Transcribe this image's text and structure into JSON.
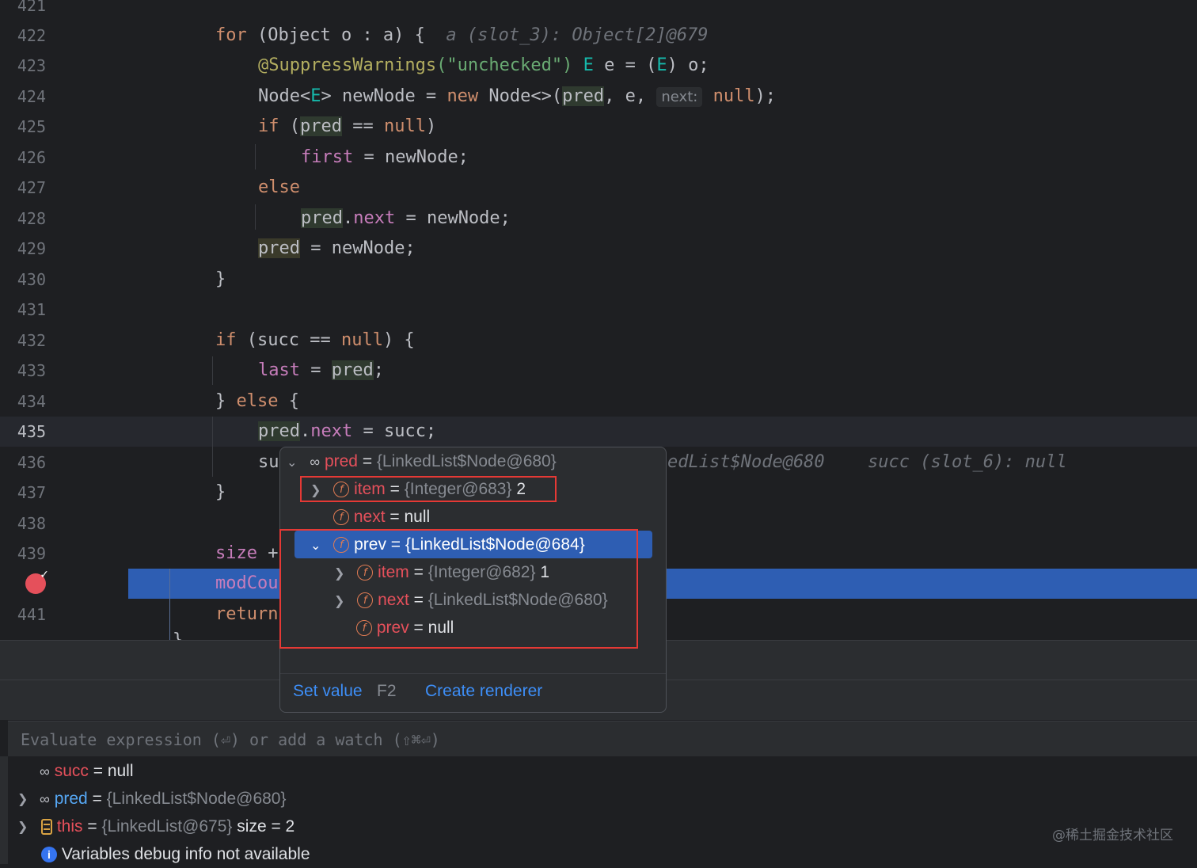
{
  "editor": {
    "lines": [
      {
        "n": "421"
      },
      {
        "n": "422"
      },
      {
        "n": "423"
      },
      {
        "n": "424"
      },
      {
        "n": "425"
      },
      {
        "n": "426"
      },
      {
        "n": "427"
      },
      {
        "n": "428"
      },
      {
        "n": "429"
      },
      {
        "n": "430"
      },
      {
        "n": "431"
      },
      {
        "n": "432"
      },
      {
        "n": "433"
      },
      {
        "n": "434"
      },
      {
        "n": "435"
      },
      {
        "n": "436"
      },
      {
        "n": "437"
      },
      {
        "n": "438"
      },
      {
        "n": "439"
      },
      {
        "n": "440"
      },
      {
        "n": "441"
      }
    ],
    "code": {
      "l422_kw": "for",
      "l422_rest": " (Object o : a) {",
      "l422_inlay": "a (slot_3): Object[2]@679",
      "l423_ann": "@SuppressWarnings",
      "l423_str": "(\"unchecked\")",
      "l423_rest1": " ",
      "l423_type": "E",
      "l423_rest2": " e = (",
      "l423_type2": "E",
      "l423_rest3": ") o;",
      "l424_a": "Node<",
      "l424_type": "E",
      "l424_b": "> newNode = ",
      "l424_new": "new",
      "l424_c": " Node<>(",
      "l424_pred": "pred",
      "l424_d": ", e, ",
      "l424_hint": "next:",
      "l424_null": "null",
      "l424_e": ");",
      "l425_if": "if",
      "l425_a": " (",
      "l425_pred": "pred",
      "l425_b": " == ",
      "l425_null": "null",
      "l425_c": ")",
      "l426_first": "first",
      "l426_rest": " = newNode;",
      "l427_else": "else",
      "l428_pred": "pred",
      "l428_dot": ".",
      "l428_next": "next",
      "l428_rest": " = newNode;",
      "l429_pred": "pred",
      "l429_rest": " = newNode;",
      "l430": "}",
      "l432_if": "if",
      "l432_a": " (succ == ",
      "l432_null": "null",
      "l432_b": ") {",
      "l433_last": "last",
      "l433_a": " = ",
      "l433_pred": "pred",
      "l433_b": ";",
      "l434_a": "} ",
      "l434_else": "else",
      "l434_b": " {",
      "l435_pred": "pred",
      "l435_dot": ".",
      "l435_next": "next",
      "l435_rest": " = succ;",
      "l436_a": "su",
      "l436_inlay1": "edList$Node@680",
      "l436_inlay2": "succ (slot_6): null",
      "l437": "}",
      "l439_size": "size",
      "l439_rest": " +",
      "l440_mod": "modCou",
      "l441_ret": "return",
      "l442": "}"
    }
  },
  "popup": {
    "root": {
      "name": "pred",
      "eq": "=",
      "value": "{LinkedList$Node@680}"
    },
    "item": {
      "name": "item",
      "eq": "=",
      "value": "{Integer@683}",
      "extra": "2"
    },
    "next": {
      "name": "next",
      "eq": "=",
      "value": "null"
    },
    "prev": {
      "name": "prev",
      "eq": "=",
      "value": "{LinkedList$Node@684}"
    },
    "prev_item": {
      "name": "item",
      "eq": "=",
      "value": "{Integer@682}",
      "extra": "1"
    },
    "prev_next": {
      "name": "next",
      "eq": "=",
      "value": "{LinkedList$Node@680}"
    },
    "prev_prev": {
      "name": "prev",
      "eq": "=",
      "value": "null"
    },
    "set_value": "Set value",
    "set_value_shortcut": "F2",
    "create_renderer": "Create renderer"
  },
  "evaluate": {
    "placeholder": "Evaluate expression (⏎) or add a watch (⇧⌘⏎)"
  },
  "variables": [
    {
      "name": "succ",
      "eq": "=",
      "value": "null"
    },
    {
      "name": "pred",
      "eq": "=",
      "value": "{LinkedList$Node@680}"
    },
    {
      "name": "this",
      "eq": "=",
      "value": "{LinkedList@675}",
      "extra": "size = 2"
    },
    {
      "message": "Variables debug info not available"
    }
  ],
  "watermark": "@稀土掘金技术社区",
  "colors": {
    "selection": "#2e5eb3",
    "breakpoint": "#e5505b",
    "annotation_box": "#e53935",
    "link": "#3d8ef7"
  }
}
